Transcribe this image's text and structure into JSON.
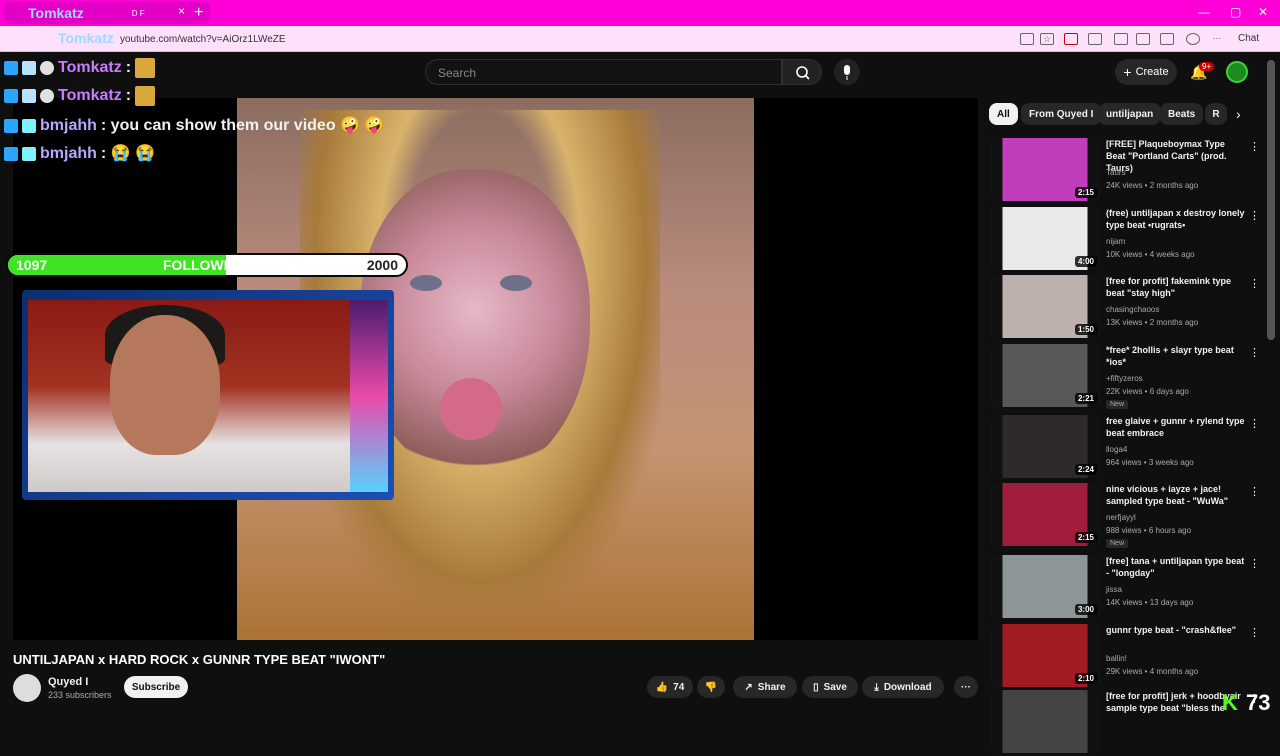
{
  "browser": {
    "tab_title": "Tomkatz",
    "tab_partial": "D F",
    "url": "youtube.com/watch?v=AiOrz1LWeZE",
    "chat_label": "Chat"
  },
  "overlay": {
    "chat": [
      {
        "user": "Tomkatz",
        "text": ":"
      },
      {
        "user": "Tomkatz",
        "text": ":"
      },
      {
        "user": "bmjahh",
        "text": ": you can show them our video 🤪 🤪"
      },
      {
        "user": "bmjahh",
        "text": ": 😭 😭"
      }
    ],
    "chat_colors": {
      "tomkatz": "#c77dff",
      "bmjahh": "#b9a6ff",
      "text": "#ffffff"
    },
    "followers": {
      "current": "1097",
      "label": "FOLLOWERS",
      "goal": "2000",
      "progress": 0.5485
    },
    "kick_count": "73"
  },
  "youtube": {
    "search_placeholder": "Search",
    "create_label": "Create",
    "notif_count": "9+",
    "video_title": "UNTILJAPAN x HARD ROCK x GUNNR TYPE BEAT \"IWONT\"",
    "channel_name": "Quyed I",
    "channel_subs": "233 subscribers",
    "subscribe_label": "Subscribe",
    "like_count": "74",
    "share_label": "Share",
    "save_label": "Save",
    "download_label": "Download",
    "chips": [
      "All",
      "From Quyed I",
      "untiljapan",
      "Beats",
      "R"
    ],
    "recommendations": [
      {
        "title": "[FREE] Plaqueboymax Type Beat \"Portland Carts\" (prod. Taurs)",
        "channel": "Taurs",
        "views": "24K views • 2 months ago",
        "duration": "2:15",
        "new": false,
        "color": "#c23dbb"
      },
      {
        "title": "(free) untiljapan x destroy lonely type beat •rugrats•",
        "channel": "nijam",
        "views": "10K views • 4 weeks ago",
        "duration": "4:00",
        "new": false,
        "color": "#e9e9e9"
      },
      {
        "title": "[free for profit] fakemink type beat \"stay high\"",
        "channel": "chasingchaoos",
        "views": "13K views • 2 months ago",
        "duration": "1:50",
        "new": false,
        "color": "#bdb1ad"
      },
      {
        "title": "*free* 2hollis + slayr type beat *ios*",
        "channel": "+fiftyzeros",
        "views": "22K views • 6 days ago",
        "duration": "2:21",
        "new": true,
        "color": "#585858"
      },
      {
        "title": "free glaive + gunnr + rylend type beat embrace",
        "channel": "lloga4",
        "views": "964 views • 3 weeks ago",
        "duration": "2:24",
        "new": false,
        "color": "#2f2a2a"
      },
      {
        "title": "nine vicious + iayze + jace! sampled type beat - \"WuWa\"",
        "channel": "nerfjayyl",
        "views": "988 views • 6 hours ago",
        "duration": "2:15",
        "new": true,
        "color": "#a01d3e"
      },
      {
        "title": "[free] tana + untiljapan type beat - \"longday\"",
        "channel": "jissa",
        "views": "14K views • 13 days ago",
        "duration": "3:00",
        "new": false,
        "color": "#8d9597"
      },
      {
        "title": "gunnr type beat - \"crash&flee\"",
        "channel": "ballin!",
        "views": "29K views • 4 months ago",
        "duration": "2:10",
        "new": false,
        "color": "#a11b22"
      },
      {
        "title": "[free for profit] jerk + hoodbyair sample type beat \"bless the",
        "channel": "",
        "views": "",
        "duration": "",
        "new": false,
        "color": "#444444"
      }
    ],
    "new_label": "New"
  }
}
